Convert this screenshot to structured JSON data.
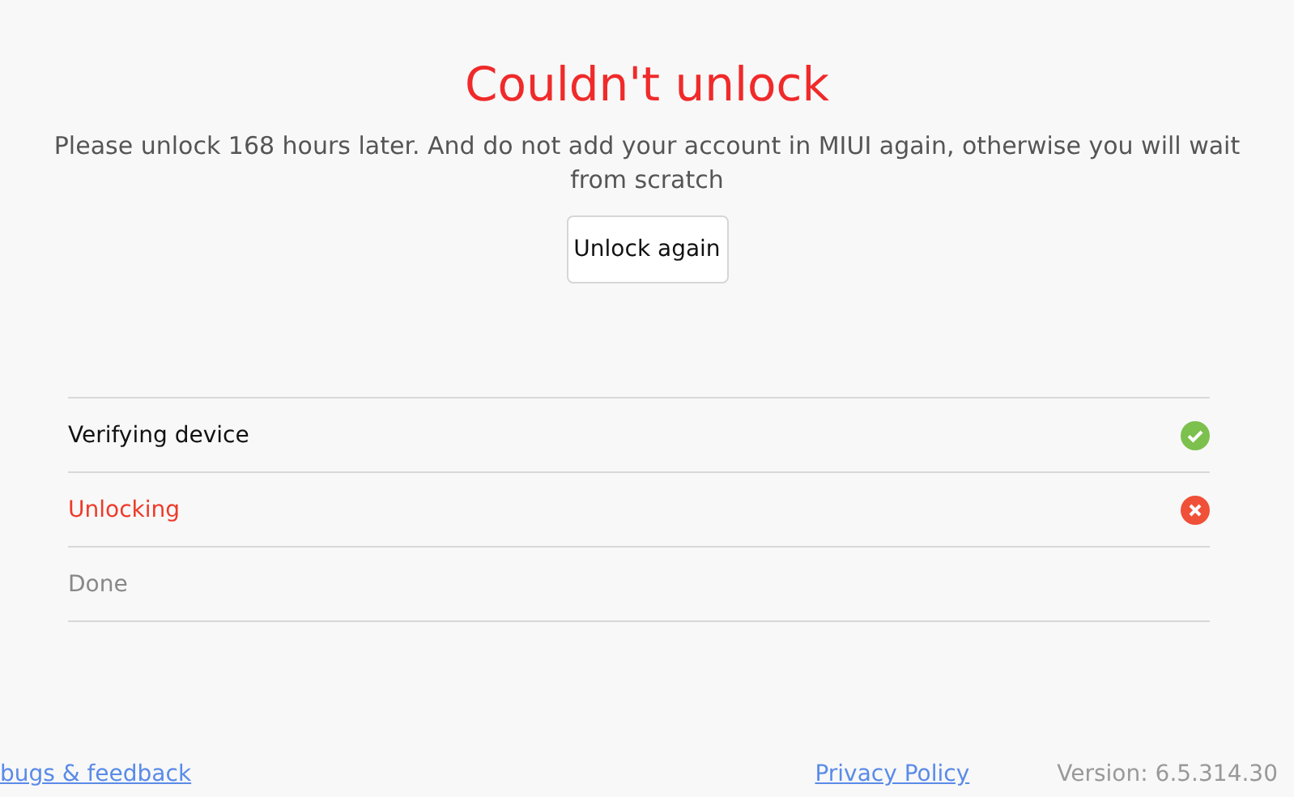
{
  "title": "Couldn't unlock",
  "message": "Please unlock 168 hours later. And do not add your account in MIUI again, otherwise you will wait from scratch",
  "button": "Unlock again",
  "steps": [
    {
      "label": "Verifying device",
      "kind": "done"
    },
    {
      "label": "Unlocking",
      "kind": "failed"
    },
    {
      "label": "Done",
      "kind": "pending"
    }
  ],
  "footer": {
    "feedback_link": "bugs & feedback",
    "privacy_link": "Privacy Policy",
    "version": "Version: 6.5.314.30"
  }
}
